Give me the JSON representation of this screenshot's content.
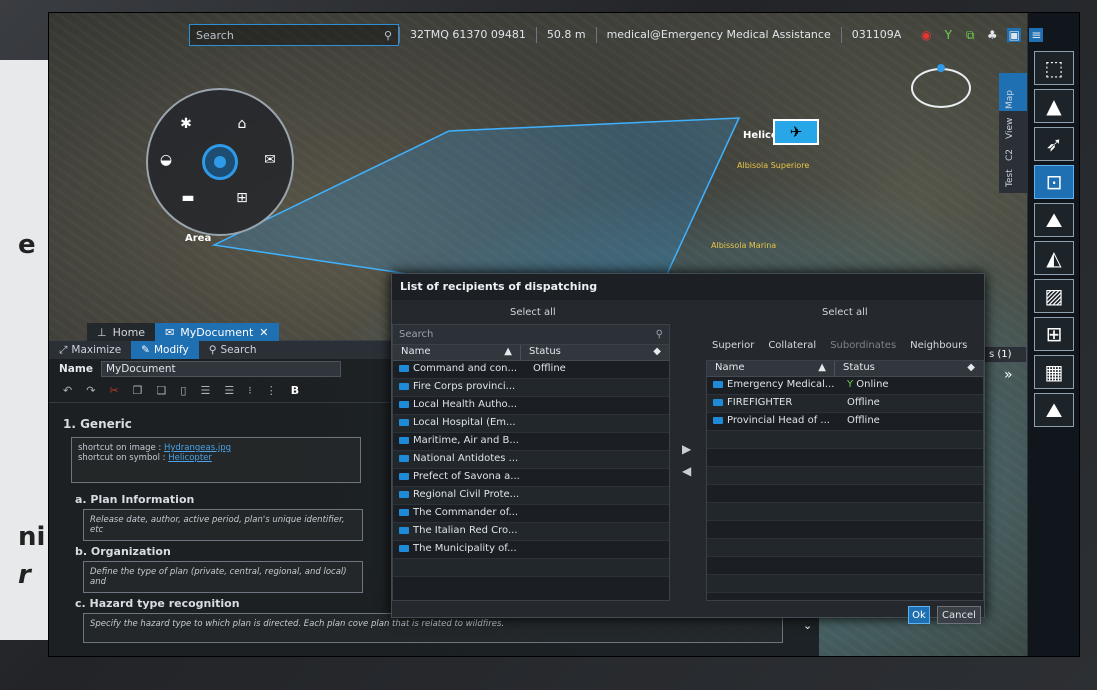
{
  "outside": {
    "letters": [
      "e",
      "ni",
      "r"
    ]
  },
  "topbar": {
    "search_placeholder": "Search",
    "coords": "32TMQ 61370 09481",
    "altitude": "50.8 m",
    "user": "medical@Emergency Medical Assistance",
    "date": "031109A"
  },
  "side_tabs": [
    "Map",
    "View",
    "C2",
    "Test"
  ],
  "map": {
    "labels": {
      "area": "Area",
      "helicopter": "Helicopter",
      "town1": "Albisola Superiore",
      "town2": "Albissola Marina"
    }
  },
  "doc": {
    "tabs": [
      {
        "label": "Home"
      },
      {
        "label": "MyDocument"
      }
    ],
    "toolbar": {
      "maximize": "Maximize",
      "modify": "Modify",
      "search": "Search"
    },
    "name_label": "Name",
    "name_value": "MyDocument",
    "section1_title": "1. Generic",
    "shortcut_image_label": "shortcut on image : ",
    "shortcut_image_link": "Hydrangeas.jpg",
    "shortcut_symbol_label": "shortcut on symbol : ",
    "shortcut_symbol_link": "Helicopter",
    "a_title": "a. Plan Information",
    "a_text": "Release date, author, active period, plan's unique identifier, etc",
    "b_title": "b. Organization",
    "b_text": "Define the type of plan (private, central, regional, and local) and",
    "c_title": "c. Hazard type recognition",
    "c_text": "Specify the hazard type to which plan is directed. Each plan cove plan that is related to wildfires."
  },
  "dialog": {
    "title": "List of recipients of dispatching",
    "select_all_left": "Select all",
    "select_all_right": "Select all",
    "search_placeholder": "Search",
    "col_name": "Name",
    "col_status": "Status",
    "filters": [
      "Superior",
      "Collateral",
      "Subordinates",
      "Neighbours"
    ],
    "left_rows": [
      {
        "name": "Command and con...",
        "status": "Offline"
      },
      {
        "name": "Fire Corps provinci...",
        "status": ""
      },
      {
        "name": "Local Health Autho...",
        "status": ""
      },
      {
        "name": "Local Hospital (Em...",
        "status": ""
      },
      {
        "name": "Maritime, Air and B...",
        "status": ""
      },
      {
        "name": "National Antidotes ...",
        "status": ""
      },
      {
        "name": "Prefect of Savona a...",
        "status": ""
      },
      {
        "name": "Regional Civil Prote...",
        "status": ""
      },
      {
        "name": "The Commander of...",
        "status": ""
      },
      {
        "name": "The Italian Red Cro...",
        "status": ""
      },
      {
        "name": "The Municipality of...",
        "status": ""
      }
    ],
    "right_rows": [
      {
        "name": "Emergency Medical...",
        "status": "Online"
      },
      {
        "name": "FIREFIGHTER",
        "status": "Offline"
      },
      {
        "name": "Provincial Head of ...",
        "status": "Offline"
      }
    ],
    "ok": "Ok",
    "cancel": "Cancel"
  },
  "behind": {
    "tab_fragment": "s (1)",
    "chevron": "»"
  }
}
